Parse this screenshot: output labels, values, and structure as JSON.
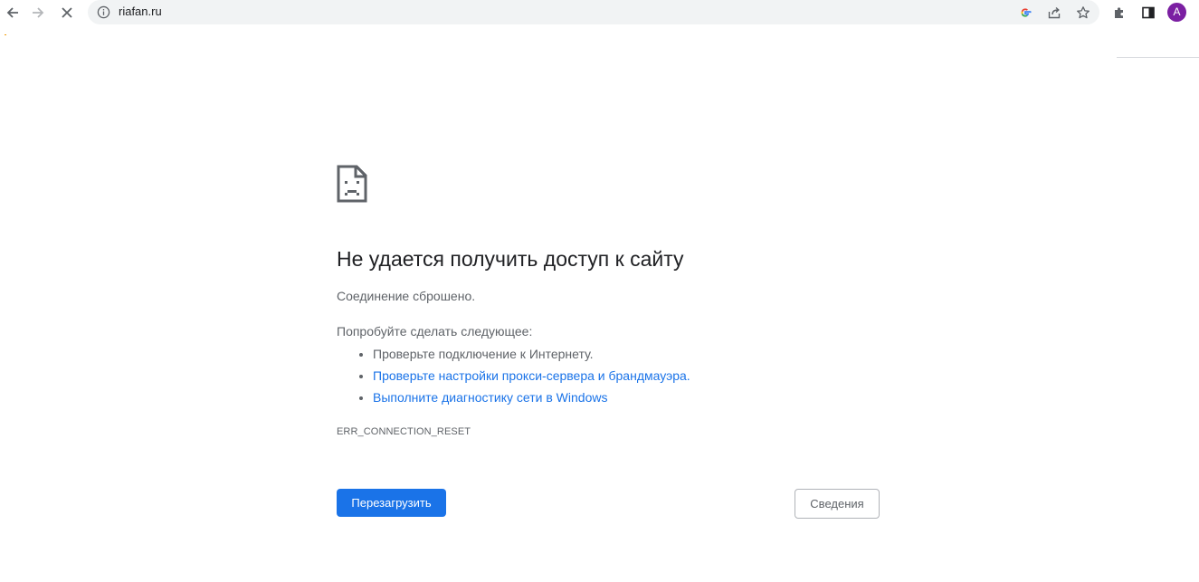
{
  "browser": {
    "url": "riafan.ru",
    "avatar_letter": "A",
    "icons": {
      "back": "back-arrow-icon",
      "forward": "forward-arrow-icon",
      "stop": "stop-loading-icon",
      "site_info": "info-icon",
      "google": "google-icon",
      "share": "share-icon",
      "bookmark": "star-icon",
      "extensions": "puzzle-icon",
      "side_panel": "side-panel-icon"
    }
  },
  "error_page": {
    "title": "Не удается получить доступ к сайту",
    "subtitle": "Соединение сброшено.",
    "suggestions_heading": "Попробуйте сделать следующее:",
    "suggestions": [
      "Проверьте подключение к Интернету.",
      "Проверьте настройки прокси-сервера и брандмауэра.",
      "Выполните диагностику сети в Windows"
    ],
    "error_code": "ERR_CONNECTION_RESET",
    "reload_label": "Перезагрузить",
    "details_label": "Сведения"
  },
  "colors": {
    "accent": "#1a73e8",
    "text": "#202124",
    "secondary_text": "#5f6368",
    "avatar_bg": "#7b1fa2"
  }
}
